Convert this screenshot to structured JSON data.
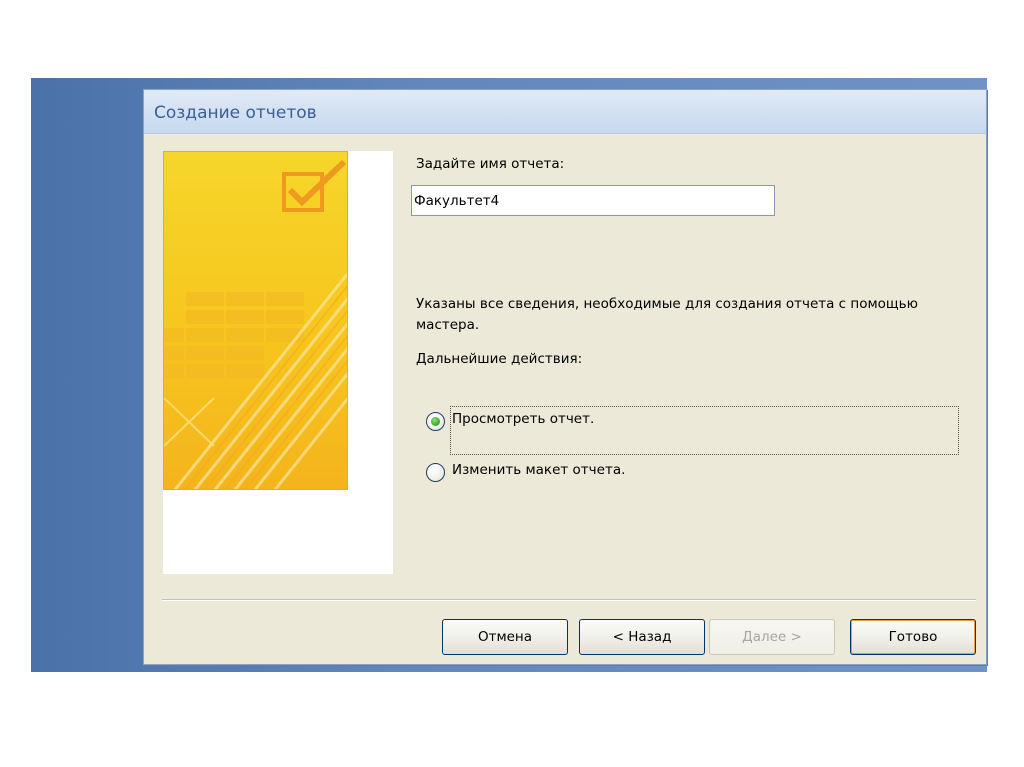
{
  "dialog": {
    "title": "Создание отчетов"
  },
  "form": {
    "name_label": "Задайте имя отчета:",
    "name_value": "Факультет4",
    "info_text": "Указаны все сведения, необходимые для создания отчета с помощью мастера.",
    "next_actions_label": "Дальнейшие действия:"
  },
  "options": [
    {
      "label": "Просмотреть отчет.",
      "selected": true
    },
    {
      "label": "Изменить макет отчета.",
      "selected": false
    }
  ],
  "buttons": {
    "cancel": "Отмена",
    "back": "< Назад",
    "next": "Далее >",
    "finish": "Готово"
  },
  "icons": {
    "wizard_art": "report-wizard-illustration",
    "checkbox": "checkmark-icon"
  },
  "colors": {
    "dialog_bg": "#ece9d8",
    "title_text": "#3a5f94",
    "radio_selected": "#3fae2f",
    "wizard_art": "#f7c51e"
  }
}
